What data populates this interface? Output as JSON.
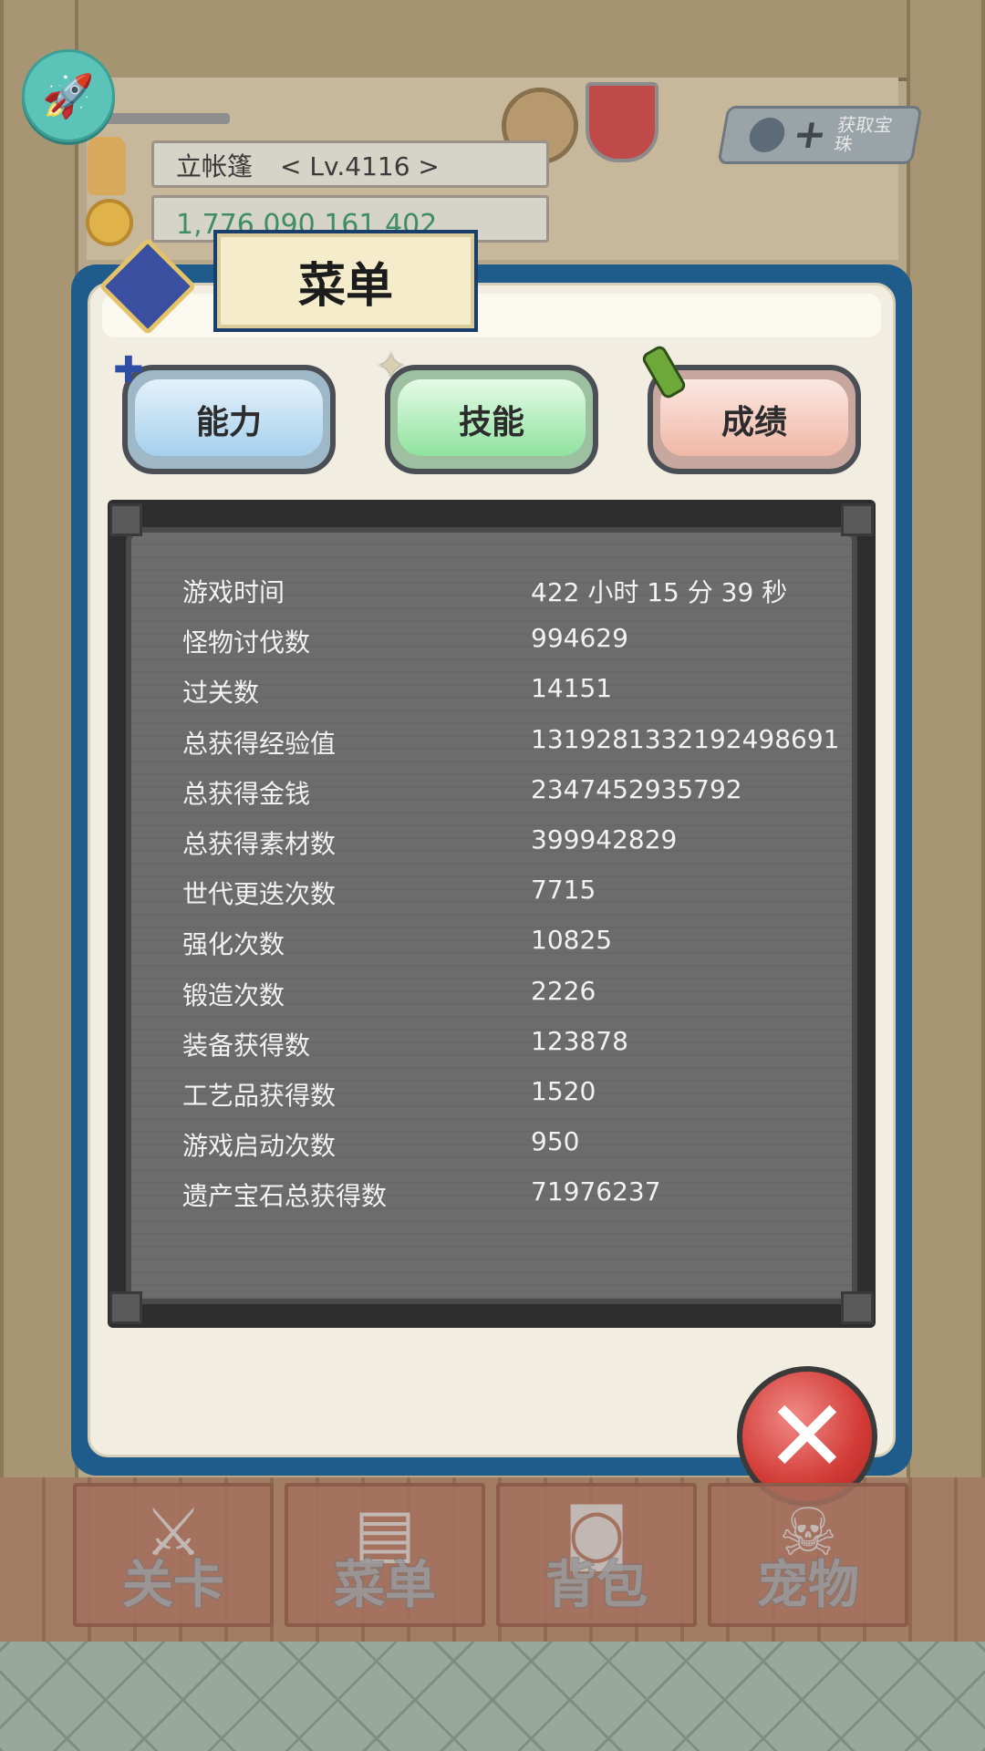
{
  "header": {
    "player_name": "立帐篷",
    "level": "< Lv.4116 >",
    "gold": "1,776,090,161,402",
    "gem_button_label": "获取宝珠"
  },
  "modal": {
    "title": "菜单",
    "tabs": [
      {
        "label": "能力"
      },
      {
        "label": "技能"
      },
      {
        "label": "成绩"
      }
    ],
    "stats": [
      {
        "key": "游戏时间",
        "value": "422 小时 15 分 39 秒"
      },
      {
        "key": "怪物讨伐数",
        "value": "994629"
      },
      {
        "key": "过关数",
        "value": "14151"
      },
      {
        "key": "总获得经验值",
        "value": "1319281332192498691"
      },
      {
        "key": "总获得金钱",
        "value": "2347452935792"
      },
      {
        "key": "总获得素材数",
        "value": "399942829"
      },
      {
        "key": "世代更迭次数",
        "value": "7715"
      },
      {
        "key": "强化次数",
        "value": "10825"
      },
      {
        "key": "锻造次数",
        "value": "2226"
      },
      {
        "key": "装备获得数",
        "value": "123878"
      },
      {
        "key": "工艺品获得数",
        "value": "1520"
      },
      {
        "key": "游戏启动次数",
        "value": "950"
      },
      {
        "key": "遗产宝石总获得数",
        "value": "71976237"
      }
    ]
  },
  "bottom_nav": [
    {
      "label": "关卡",
      "icon": "crossed-swords-icon"
    },
    {
      "label": "菜单",
      "icon": "book-icon"
    },
    {
      "label": "背包",
      "icon": "backpack-icon"
    },
    {
      "label": "宠物",
      "icon": "pet-icon"
    }
  ]
}
